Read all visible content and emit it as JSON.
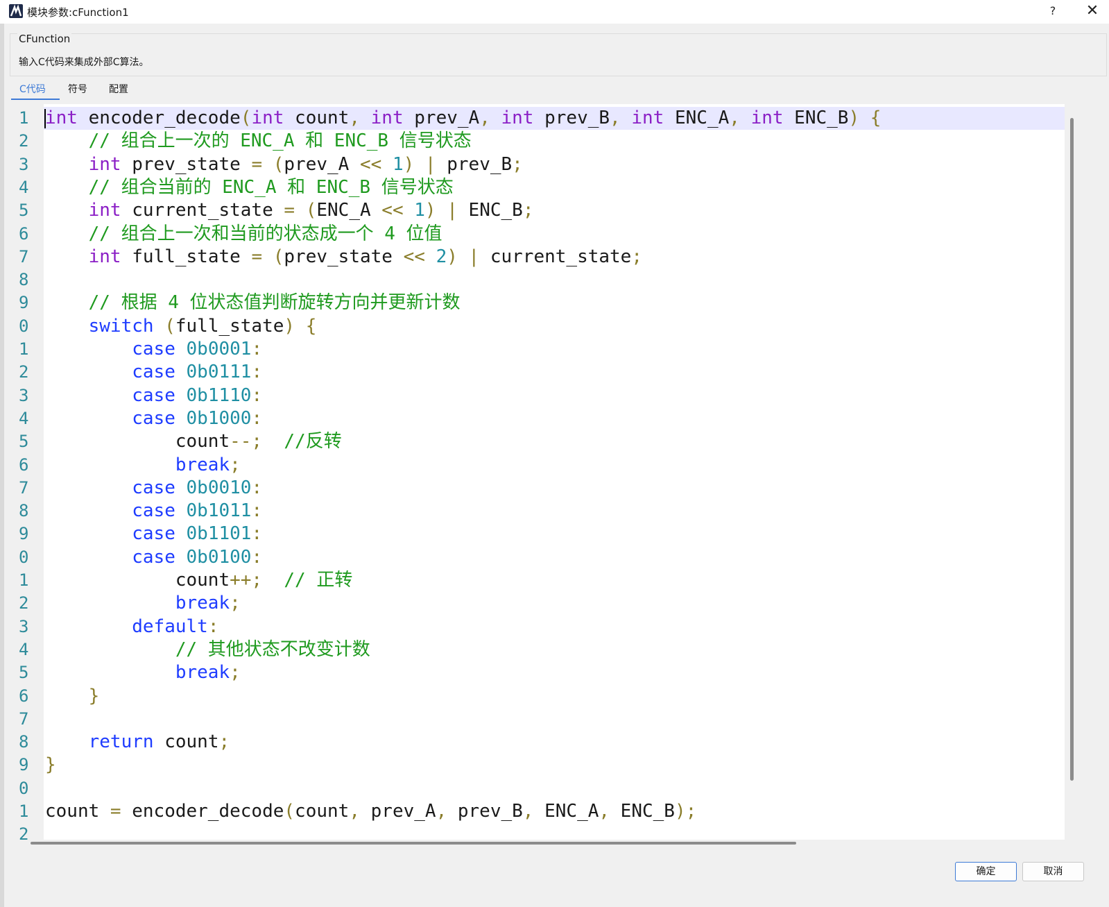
{
  "window": {
    "title": "模块参数:cFunction1",
    "help_label": "?",
    "close_label": "✕"
  },
  "group": {
    "title": "CFunction",
    "description": "输入C代码来集成外部C算法。"
  },
  "tabs": [
    {
      "label": "C代码",
      "active": true
    },
    {
      "label": "符号",
      "active": false
    },
    {
      "label": "配置",
      "active": false
    }
  ],
  "editor": {
    "line_numbers": [
      "1",
      "2",
      "3",
      "4",
      "5",
      "6",
      "7",
      "8",
      "9",
      "0",
      "1",
      "2",
      "3",
      "4",
      "5",
      "6",
      "7",
      "8",
      "9",
      "0",
      "1",
      "2",
      "3",
      "4",
      "5",
      "6",
      "7",
      "8",
      "9",
      "0",
      "1",
      "2"
    ],
    "lines": [
      [
        {
          "t": "int",
          "c": "kw-purple"
        },
        {
          "t": " encoder_decode",
          "c": "plain"
        },
        {
          "t": "(",
          "c": "op"
        },
        {
          "t": "int",
          "c": "kw-purple"
        },
        {
          "t": " count",
          "c": "plain"
        },
        {
          "t": ",",
          "c": "op"
        },
        {
          "t": " ",
          "c": "plain"
        },
        {
          "t": "int",
          "c": "kw-purple"
        },
        {
          "t": " prev_A",
          "c": "plain"
        },
        {
          "t": ",",
          "c": "op"
        },
        {
          "t": " ",
          "c": "plain"
        },
        {
          "t": "int",
          "c": "kw-purple"
        },
        {
          "t": " prev_B",
          "c": "plain"
        },
        {
          "t": ",",
          "c": "op"
        },
        {
          "t": " ",
          "c": "plain"
        },
        {
          "t": "int",
          "c": "kw-purple"
        },
        {
          "t": " ENC_A",
          "c": "plain"
        },
        {
          "t": ",",
          "c": "op"
        },
        {
          "t": " ",
          "c": "plain"
        },
        {
          "t": "int",
          "c": "kw-purple"
        },
        {
          "t": " ENC_B",
          "c": "plain"
        },
        {
          "t": ")",
          "c": "op"
        },
        {
          "t": " {",
          "c": "op"
        }
      ],
      [
        {
          "t": "    // 组合上一次的 ENC_A 和 ENC_B 信号状态",
          "c": "cmt"
        }
      ],
      [
        {
          "t": "    ",
          "c": "plain"
        },
        {
          "t": "int",
          "c": "kw-purple"
        },
        {
          "t": " prev_state ",
          "c": "plain"
        },
        {
          "t": "=",
          "c": "op"
        },
        {
          "t": " ",
          "c": "plain"
        },
        {
          "t": "(",
          "c": "op"
        },
        {
          "t": "prev_A ",
          "c": "plain"
        },
        {
          "t": "<<",
          "c": "op"
        },
        {
          "t": " ",
          "c": "plain"
        },
        {
          "t": "1",
          "c": "num"
        },
        {
          "t": ")",
          "c": "op"
        },
        {
          "t": " ",
          "c": "plain"
        },
        {
          "t": "|",
          "c": "op"
        },
        {
          "t": " prev_B",
          "c": "plain"
        },
        {
          "t": ";",
          "c": "op"
        }
      ],
      [
        {
          "t": "    // 组合当前的 ENC_A 和 ENC_B 信号状态",
          "c": "cmt"
        }
      ],
      [
        {
          "t": "    ",
          "c": "plain"
        },
        {
          "t": "int",
          "c": "kw-purple"
        },
        {
          "t": " current_state ",
          "c": "plain"
        },
        {
          "t": "=",
          "c": "op"
        },
        {
          "t": " ",
          "c": "plain"
        },
        {
          "t": "(",
          "c": "op"
        },
        {
          "t": "ENC_A ",
          "c": "plain"
        },
        {
          "t": "<<",
          "c": "op"
        },
        {
          "t": " ",
          "c": "plain"
        },
        {
          "t": "1",
          "c": "num"
        },
        {
          "t": ")",
          "c": "op"
        },
        {
          "t": " ",
          "c": "plain"
        },
        {
          "t": "|",
          "c": "op"
        },
        {
          "t": " ENC_B",
          "c": "plain"
        },
        {
          "t": ";",
          "c": "op"
        }
      ],
      [
        {
          "t": "    // 组合上一次和当前的状态成一个 4 位值",
          "c": "cmt"
        }
      ],
      [
        {
          "t": "    ",
          "c": "plain"
        },
        {
          "t": "int",
          "c": "kw-purple"
        },
        {
          "t": " full_state ",
          "c": "plain"
        },
        {
          "t": "=",
          "c": "op"
        },
        {
          "t": " ",
          "c": "plain"
        },
        {
          "t": "(",
          "c": "op"
        },
        {
          "t": "prev_state ",
          "c": "plain"
        },
        {
          "t": "<<",
          "c": "op"
        },
        {
          "t": " ",
          "c": "plain"
        },
        {
          "t": "2",
          "c": "num"
        },
        {
          "t": ")",
          "c": "op"
        },
        {
          "t": " ",
          "c": "plain"
        },
        {
          "t": "|",
          "c": "op"
        },
        {
          "t": " current_state",
          "c": "plain"
        },
        {
          "t": ";",
          "c": "op"
        }
      ],
      [
        {
          "t": "",
          "c": "plain"
        }
      ],
      [
        {
          "t": "    // 根据 4 位状态值判断旋转方向并更新计数",
          "c": "cmt"
        }
      ],
      [
        {
          "t": "    ",
          "c": "plain"
        },
        {
          "t": "switch",
          "c": "kw-blue"
        },
        {
          "t": " ",
          "c": "plain"
        },
        {
          "t": "(",
          "c": "op"
        },
        {
          "t": "full_state",
          "c": "plain"
        },
        {
          "t": ")",
          "c": "op"
        },
        {
          "t": " {",
          "c": "op"
        }
      ],
      [
        {
          "t": "        ",
          "c": "plain"
        },
        {
          "t": "case",
          "c": "kw-blue"
        },
        {
          "t": " ",
          "c": "plain"
        },
        {
          "t": "0b0001",
          "c": "num"
        },
        {
          "t": ":",
          "c": "op"
        }
      ],
      [
        {
          "t": "        ",
          "c": "plain"
        },
        {
          "t": "case",
          "c": "kw-blue"
        },
        {
          "t": " ",
          "c": "plain"
        },
        {
          "t": "0b0111",
          "c": "num"
        },
        {
          "t": ":",
          "c": "op"
        }
      ],
      [
        {
          "t": "        ",
          "c": "plain"
        },
        {
          "t": "case",
          "c": "kw-blue"
        },
        {
          "t": " ",
          "c": "plain"
        },
        {
          "t": "0b1110",
          "c": "num"
        },
        {
          "t": ":",
          "c": "op"
        }
      ],
      [
        {
          "t": "        ",
          "c": "plain"
        },
        {
          "t": "case",
          "c": "kw-blue"
        },
        {
          "t": " ",
          "c": "plain"
        },
        {
          "t": "0b1000",
          "c": "num"
        },
        {
          "t": ":",
          "c": "op"
        }
      ],
      [
        {
          "t": "            count",
          "c": "plain"
        },
        {
          "t": "--",
          "c": "op"
        },
        {
          "t": ";",
          "c": "op"
        },
        {
          "t": "  //反转",
          "c": "cmt"
        }
      ],
      [
        {
          "t": "            ",
          "c": "plain"
        },
        {
          "t": "break",
          "c": "kw-blue"
        },
        {
          "t": ";",
          "c": "op"
        }
      ],
      [
        {
          "t": "        ",
          "c": "plain"
        },
        {
          "t": "case",
          "c": "kw-blue"
        },
        {
          "t": " ",
          "c": "plain"
        },
        {
          "t": "0b0010",
          "c": "num"
        },
        {
          "t": ":",
          "c": "op"
        }
      ],
      [
        {
          "t": "        ",
          "c": "plain"
        },
        {
          "t": "case",
          "c": "kw-blue"
        },
        {
          "t": " ",
          "c": "plain"
        },
        {
          "t": "0b1011",
          "c": "num"
        },
        {
          "t": ":",
          "c": "op"
        }
      ],
      [
        {
          "t": "        ",
          "c": "plain"
        },
        {
          "t": "case",
          "c": "kw-blue"
        },
        {
          "t": " ",
          "c": "plain"
        },
        {
          "t": "0b1101",
          "c": "num"
        },
        {
          "t": ":",
          "c": "op"
        }
      ],
      [
        {
          "t": "        ",
          "c": "plain"
        },
        {
          "t": "case",
          "c": "kw-blue"
        },
        {
          "t": " ",
          "c": "plain"
        },
        {
          "t": "0b0100",
          "c": "num"
        },
        {
          "t": ":",
          "c": "op"
        }
      ],
      [
        {
          "t": "            count",
          "c": "plain"
        },
        {
          "t": "++",
          "c": "op"
        },
        {
          "t": ";",
          "c": "op"
        },
        {
          "t": "  // 正转",
          "c": "cmt"
        }
      ],
      [
        {
          "t": "            ",
          "c": "plain"
        },
        {
          "t": "break",
          "c": "kw-blue"
        },
        {
          "t": ";",
          "c": "op"
        }
      ],
      [
        {
          "t": "        ",
          "c": "plain"
        },
        {
          "t": "default",
          "c": "kw-blue"
        },
        {
          "t": ":",
          "c": "op"
        }
      ],
      [
        {
          "t": "            // 其他状态不改变计数",
          "c": "cmt"
        }
      ],
      [
        {
          "t": "            ",
          "c": "plain"
        },
        {
          "t": "break",
          "c": "kw-blue"
        },
        {
          "t": ";",
          "c": "op"
        }
      ],
      [
        {
          "t": "    ",
          "c": "plain"
        },
        {
          "t": "}",
          "c": "op"
        }
      ],
      [
        {
          "t": "",
          "c": "plain"
        }
      ],
      [
        {
          "t": "    ",
          "c": "plain"
        },
        {
          "t": "return",
          "c": "kw-blue"
        },
        {
          "t": " count",
          "c": "plain"
        },
        {
          "t": ";",
          "c": "op"
        }
      ],
      [
        {
          "t": "}",
          "c": "op"
        }
      ],
      [
        {
          "t": "",
          "c": "plain"
        }
      ],
      [
        {
          "t": "count ",
          "c": "plain"
        },
        {
          "t": "=",
          "c": "op"
        },
        {
          "t": " encoder_decode",
          "c": "plain"
        },
        {
          "t": "(",
          "c": "op"
        },
        {
          "t": "count",
          "c": "plain"
        },
        {
          "t": ",",
          "c": "op"
        },
        {
          "t": " prev_A",
          "c": "plain"
        },
        {
          "t": ",",
          "c": "op"
        },
        {
          "t": " prev_B",
          "c": "plain"
        },
        {
          "t": ",",
          "c": "op"
        },
        {
          "t": " ENC_A",
          "c": "plain"
        },
        {
          "t": ",",
          "c": "op"
        },
        {
          "t": " ENC_B",
          "c": "plain"
        },
        {
          "t": ")",
          "c": "op"
        },
        {
          "t": ";",
          "c": "op"
        }
      ]
    ]
  },
  "buttons": {
    "ok_label": "确定",
    "cancel_label": "取消"
  }
}
